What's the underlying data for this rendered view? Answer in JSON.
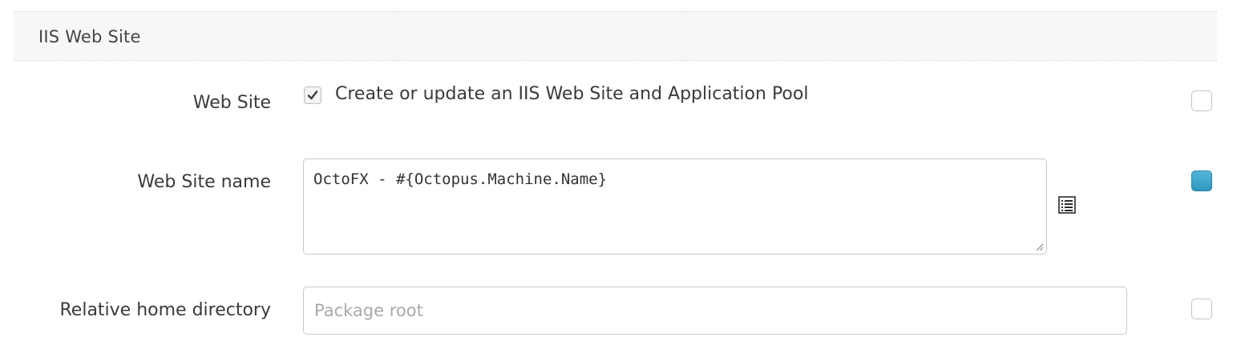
{
  "section": {
    "title": "IIS Web Site"
  },
  "fields": {
    "website": {
      "label": "Web Site",
      "checkbox_checked": true,
      "checkbox_label": "Create or update an IIS Web Site and Application Pool",
      "bind_checked": false
    },
    "website_name": {
      "label": "Web Site name",
      "value": "OctoFX - #{Octopus.Machine.Name}",
      "bind_checked": true
    },
    "home_directory": {
      "label": "Relative home directory",
      "value": "",
      "placeholder": "Package root",
      "bind_checked": false
    }
  },
  "icons": {
    "checkmark": "checkmark-icon",
    "variable_picker": "variable-list-icon",
    "resize": "resize-grip-icon"
  },
  "colors": {
    "bind_active": "#3aa4cc",
    "section_bg": "#f7f7f7"
  }
}
